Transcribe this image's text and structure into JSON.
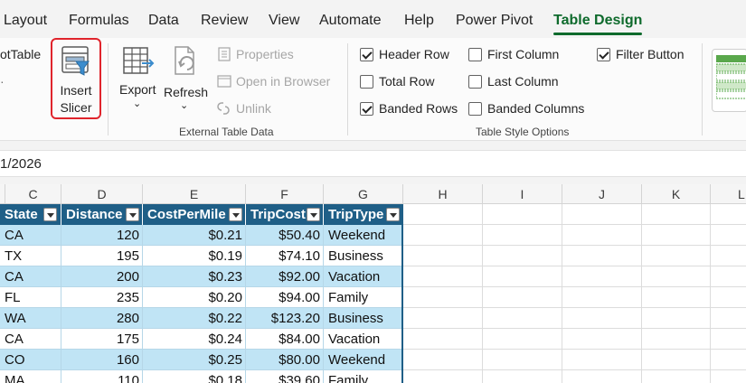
{
  "menu": {
    "tabs": [
      "Layout",
      "Formulas",
      "Data",
      "Review",
      "View",
      "Automate",
      "Help",
      "Power Pivot",
      "Table Design"
    ],
    "active": "Table Design"
  },
  "ribbon": {
    "pivot_label": "otTable",
    "insert_slicer": {
      "line1": "Insert",
      "line2": "Slicer"
    },
    "export_label": "Export",
    "refresh_label": "Refresh",
    "properties_label": "Properties",
    "open_browser_label": "Open in Browser",
    "unlink_label": "Unlink",
    "external_group_label": "External Table Data",
    "style_options": {
      "header_row": {
        "label": "Header Row",
        "checked": true
      },
      "total_row": {
        "label": "Total Row",
        "checked": false
      },
      "banded_rows": {
        "label": "Banded Rows",
        "checked": true
      },
      "first_column": {
        "label": "First Column",
        "checked": false
      },
      "last_column": {
        "label": "Last Column",
        "checked": false
      },
      "banded_columns": {
        "label": "Banded Columns",
        "checked": false
      },
      "filter_button": {
        "label": "Filter Button",
        "checked": true
      },
      "group_label": "Table Style Options"
    }
  },
  "formula_bar": {
    "value": "1/2026"
  },
  "grid": {
    "column_letters": [
      "C",
      "D",
      "E",
      "F",
      "G",
      "H",
      "I",
      "J",
      "K",
      "L"
    ],
    "table_headers": [
      "State",
      "Distance",
      "CostPerMile",
      "TripCost",
      "TripType"
    ],
    "rows": [
      [
        "CA",
        "120",
        "$0.21",
        "$50.40",
        "Weekend"
      ],
      [
        "TX",
        "195",
        "$0.19",
        "$74.10",
        "Business"
      ],
      [
        "CA",
        "200",
        "$0.23",
        "$92.00",
        "Vacation"
      ],
      [
        "FL",
        "235",
        "$0.20",
        "$94.00",
        "Family"
      ],
      [
        "WA",
        "280",
        "$0.22",
        "$123.20",
        "Business"
      ],
      [
        "CA",
        "175",
        "$0.24",
        "$84.00",
        "Vacation"
      ],
      [
        "CO",
        "160",
        "$0.25",
        "$80.00",
        "Weekend"
      ],
      [
        "MA",
        "110",
        "$0.18",
        "$39.60",
        "Family"
      ]
    ]
  },
  "colors": {
    "accent_green": "#0e6a2c",
    "table_header": "#1f5f87",
    "band": "#c0e4f5",
    "highlight_red": "#e0242c"
  }
}
